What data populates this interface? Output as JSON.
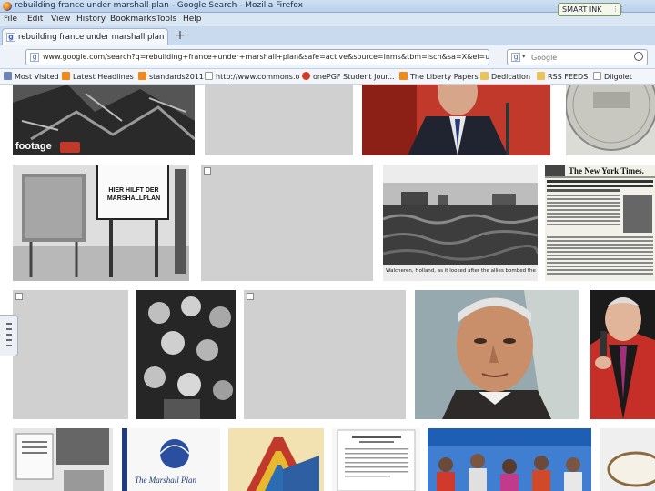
{
  "window": {
    "title": "rebuilding france under marshall plan - Google Search - Mozilla Firefox"
  },
  "smart_ink": {
    "label": "SMART INK"
  },
  "menu": [
    {
      "label": "File"
    },
    {
      "label": "Edit"
    },
    {
      "label": "View"
    },
    {
      "label": "History"
    },
    {
      "label": "Bookmarks"
    },
    {
      "label": "Tools"
    },
    {
      "label": "Help"
    }
  ],
  "tab": {
    "label": "rebuilding france under marshall plan - Goog",
    "new_tab": "+"
  },
  "navbar": {
    "url": "www.google.com/search?q=rebuilding+france+under+marshall+plan&safe=active&source=lnms&tbm=isch&sa=X&ei=uzsZU7",
    "search_engine": "Google",
    "search_placeholder": "Google"
  },
  "bookmarks": [
    {
      "label": "Most Visited",
      "icon": "star-icon"
    },
    {
      "label": "Latest Headlines",
      "icon": "rss-icon"
    },
    {
      "label": "standards2011",
      "icon": "rss-icon"
    },
    {
      "label": "http://www.commons.o",
      "icon": "page-icon"
    },
    {
      "label": "onePGF Student Jour...",
      "icon": "tomato-icon"
    },
    {
      "label": "The Liberty Papers",
      "icon": "rss-icon"
    },
    {
      "label": "Dedication",
      "icon": "folder-icon"
    },
    {
      "label": "RSS FEEDS",
      "icon": "folder-icon"
    },
    {
      "label": "Diigolet",
      "icon": "page-icon"
    }
  ],
  "images": {
    "footage_watermark": "footage",
    "sign_text": "HIER HILFT DER MARSHALLPLAN",
    "newspaper_masthead": "The New York Times.",
    "flood_caption": "Walcheren, Holland, as it looked after the allies bombed the dyke...",
    "poster_text": "The Marshall Plan"
  },
  "colors": {
    "titlebar": "#c3d7ef",
    "placeholder": "#d0d0d0",
    "tab_bg": "#f4f7fb"
  }
}
